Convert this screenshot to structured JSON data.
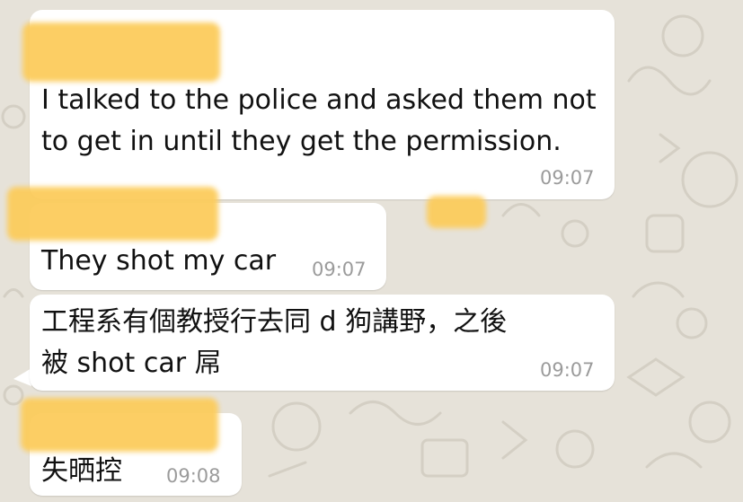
{
  "messages": [
    {
      "text": "I talked to the police and asked them not\nto get in until they get the permission.",
      "time": "09:07"
    },
    {
      "text": "They shot my car",
      "time": "09:07"
    },
    {
      "text": "工程系有個教授行去同 d 狗講野，之後\n被 shot car 屌",
      "time": "09:07"
    },
    {
      "text": "失晒控",
      "time": "09:08"
    }
  ],
  "colors": {
    "bubble": "#ffffff",
    "wallpaper": "#e6e2d9",
    "redaction": "#fccc5c",
    "timestamp": "#9b9b9b"
  }
}
